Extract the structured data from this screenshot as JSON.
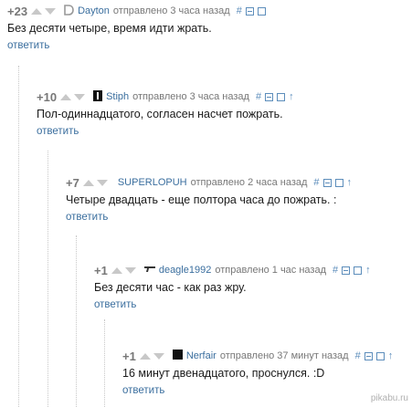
{
  "comments": [
    {
      "score": "+23",
      "user": "Dayton",
      "sent": "отправлено",
      "time": "3 часа назад",
      "text": "Без десяти четыре, время идти жрать.",
      "reply": "ответить",
      "avatar_icon": "letter-d-avatar",
      "tools": {
        "hash": "#",
        "arrow": ""
      }
    },
    {
      "score": "+10",
      "user": "Stiph",
      "sent": "отправлено",
      "time": "3 часа назад",
      "text": "Пол-одиннадцатого, согласен насчет пожрать.",
      "reply": "ответить",
      "avatar_icon": "bottle-avatar",
      "tools": {
        "hash": "#",
        "arrow": "↑"
      }
    },
    {
      "score": "+7",
      "user": "SUPERLOPUH",
      "sent": "отправлено",
      "time": "2 часа назад",
      "text": "Четыре двадцать - еще полтора часа до пожрать. :",
      "reply": "ответить",
      "avatar_icon": "none",
      "tools": {
        "hash": "#",
        "arrow": "↑"
      }
    },
    {
      "score": "+1",
      "user": "deagle1992",
      "sent": "отправлено",
      "time": "1 час назад",
      "text": "Без десяти час - как раз жру.",
      "reply": "ответить",
      "avatar_icon": "gun-avatar",
      "tools": {
        "hash": "#",
        "arrow": "↑"
      }
    },
    {
      "score": "+1",
      "user": "Nerfair",
      "sent": "отправлено",
      "time": "37 минут назад",
      "text": "16 минут двенадцатого, проснулся. :D",
      "reply": "ответить",
      "avatar_icon": "black-square-avatar",
      "tools": {
        "hash": "#",
        "arrow": "↑"
      }
    }
  ],
  "watermark": "pikabu.ru",
  "colors": {
    "link": "#3a6e9e",
    "muted": "#777777",
    "arrow": "#c8c8c8",
    "tool": "#5c8dbb"
  }
}
